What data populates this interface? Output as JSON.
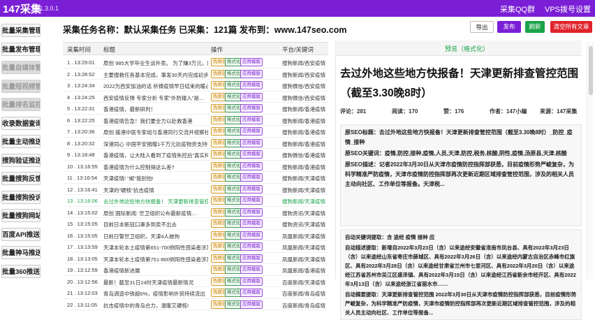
{
  "titlebar": {
    "app_title": "147采集",
    "version": "v1.3.0.1",
    "link_qq": "采集QQ群",
    "link_vps": "VPS拨号设置",
    "color": "#7b1fd6"
  },
  "sidebar": {
    "items": [
      {
        "label": "批量采集管理",
        "disabled": false
      },
      {
        "label": "批量发布管理",
        "disabled": false
      },
      {
        "label": "批量自媒体管理",
        "disabled": true
      },
      {
        "label": "批量短视频管理",
        "disabled": true
      },
      {
        "label": "批量排名监控",
        "disabled": true
      },
      {
        "label": "收录数据查询",
        "disabled": false
      },
      {
        "label": "批量主动推送",
        "disabled": false
      },
      {
        "label": "搜狗验证推送",
        "disabled": false
      },
      {
        "label": "批量搜狗反馈",
        "disabled": false
      },
      {
        "label": "批量搜狗投诉",
        "disabled": false
      },
      {
        "label": "批量搜狗网站",
        "disabled": false
      },
      {
        "label": "百度API推送",
        "disabled": false
      },
      {
        "label": "批量神马推送",
        "disabled": false
      },
      {
        "label": "批量360推送",
        "disabled": false
      }
    ]
  },
  "topbar": {
    "task_line": "采集任务名称：默认采集任务 已采集：121篇 发布到：www.147seo.com",
    "btn_export": "导出",
    "btn_publish": "发布",
    "btn_refresh": "刷新",
    "btn_clear": "清空所有文章"
  },
  "table": {
    "headers": {
      "time": "采集时间",
      "title": "标题",
      "action": "操作",
      "site": "平台/关键词"
    },
    "tags": {
      "a": "伪原创",
      "b": "格式化",
      "c": "应用模版"
    },
    "rows": [
      {
        "time": "1 . 13:29:01",
        "title": "原创 985大学毕业生谈外卖。 为了赚3万元，同...",
        "site": "搜狗新闻/西安疫情"
      },
      {
        "time": "2 . 13:28:52",
        "title": "主要搜救任务基本完成，事发30天内完成初步调查...",
        "site": "搜狗新闻/西安疫情"
      },
      {
        "time": "3 . 13:24:34",
        "title": "2022为西安加油的话 祈祷疫情早日结束的暖心...",
        "site": "搜狗微信/西安疫情"
      },
      {
        "time": "4 . 13:24:25",
        "title": "西安疫情反弹 专家分析 专家\"外防输入\"是...",
        "site": "搜狗微信/西安疫情"
      },
      {
        "time": "5 . 13:22:31",
        "title": "香港疫情，最新研判！",
        "site": "搜狗新闻/香港疫情"
      },
      {
        "time": "6 . 13:22:25",
        "title": "香港疫情告急！我们要全力以赴救香港",
        "site": "搜狗新闻/香港疫情"
      },
      {
        "time": "7 . 13:20:36",
        "title": "原创 援港中医专家组与香港同行交流并视察社区...",
        "site": "搜狗新闻/香港疫情"
      },
      {
        "time": "8 . 13:20:32",
        "title": "深港同心 中国平安捐赠1千万元抗疫物资支持香港...",
        "site": "搜狗新闻/香港疫情"
      },
      {
        "time": "9 . 13:18:48",
        "title": "香港疫情，让大陆人看到了疫情失控后\"真实样板\"",
        "site": "搜狗微信/香港疫情"
      },
      {
        "time": "10 . 13:16:55",
        "title": "香港疫情为什么控制得这么差?",
        "site": "搜狗新闻/香港疫情"
      },
      {
        "time": "11 . 13:16:54",
        "title": "天津疫情! \"邮\"我别怕!",
        "site": "搜狗新闻/天津疫情"
      },
      {
        "time": "12 . 13:16:41",
        "title": "天津的\"硬核\"抗击疫情",
        "site": "搜狗新闻/天津疫情"
      },
      {
        "time": "13 . 13:16:06",
        "title": "去过外地这些地方快报备！ 天津更新排查管控范围...",
        "site": "搜狗新闻/天津疫情",
        "highlight": true
      },
      {
        "time": "14 . 13:15:02",
        "title": "原创 国际新闻: 世卫组织公布最新疫情...",
        "site": "搜狗资讯/天津疫情"
      },
      {
        "time": "15 . 13:15:05",
        "title": "目前日本新冠口罩多到卖不出去",
        "site": "搜狗资讯/天津疫情"
      },
      {
        "time": "16 . 13:15:05",
        "title": "日前日警世卫组织，天津4人被拘",
        "site": "凤凰新闻/天津疫情"
      },
      {
        "time": "17 . 13:13:59",
        "title": "天津本轮本土疫情第651-700例阳性感染者涉及...",
        "site": "凤凰新闻/天津疫情"
      },
      {
        "time": "18 . 13:13:05",
        "title": "天津本轮本土疫情第751-800例阳性感染者涉及...",
        "site": "凤凰新闻/天津疫情"
      },
      {
        "time": "19 . 13:12:59",
        "title": "香港疫情新进展",
        "site": "凤凰新闻/香港疫情"
      },
      {
        "time": "20 . 13:12:56",
        "title": "最新！截至31日24时天津疫情最新情况",
        "site": "百度新闻/天津疫情"
      },
      {
        "time": "21 . 13:12:03",
        "title": "青岛调造中铁超6%，疫情影响外贸持续流出",
        "site": "百度新闻/青岛疫情"
      },
      {
        "time": "22 . 13:11:05",
        "title": "抗击疫情中的青岛合力，温暖又硬核!",
        "site": "百度新闻/青岛疫情"
      }
    ]
  },
  "panel": {
    "head_label": "预览（格式化）",
    "article_title": "去过外地这些地方快报备！天津更新排查管控范围（截至3.30晚8时）",
    "meta": {
      "comments": "评论：281",
      "reads": "阅读：170",
      "likes": "赞：176",
      "author": "作者：147小编",
      "source": "来源：147采集"
    },
    "seo_lines": [
      "原SEO标题：去过外地这些地方快报备！天津更新排查管控范围（截至3.30晚8时）_防控_疫情_接种",
      "原SEO关键词：疫情,防控,接种,疫情,人员,天津,防控,税务,核酸,阴性,疫情,汤原县,天津,核酸",
      "原SEO描述：记者2022年3月30日从天津市疫情防控指挥部获悉，目前疫情形势严峻复杂，为科学精准严防疫情，天津市疫情防控指挥部再次更新近期区域排查管控范围，涉及的相关人员主动向社区、工作单位等报备。天津税..."
    ],
    "seo2_lines": [
      "自动关键词提取：含 途经 疫情 接种 应",
      "自动描述提取：新增自2022年3月23日（含）以来途经安徽省淮南市凤台县、具有2022年3月23日（含）以来途经山东省枣庄市薛城区、具有2022年3月26日（含）以来途经内蒙古自治区赤峰市红旗区、具有2022年3月28日（含）以来途经甘肃省兰州市七里河区、具有2022年3月20日（含）以来途经江苏省苏州市吴江区盛泽镇、具有2022年3月15日（含）以来途经江西省新余市经开区、具有2022年3月13日（含）以来途经浙江省丽水市……",
      "自动摘要提取：天津更新排查管控范围 2022年3月30日从天津市疫情防控指挥部获悉，目前疫情形势严峻复杂，为科学精准严防疫情，天津市疫情防控指挥部再次更新近期区域排查管控范围，涉及的相关人员主动向社区、工作单位等报备..."
    ]
  }
}
